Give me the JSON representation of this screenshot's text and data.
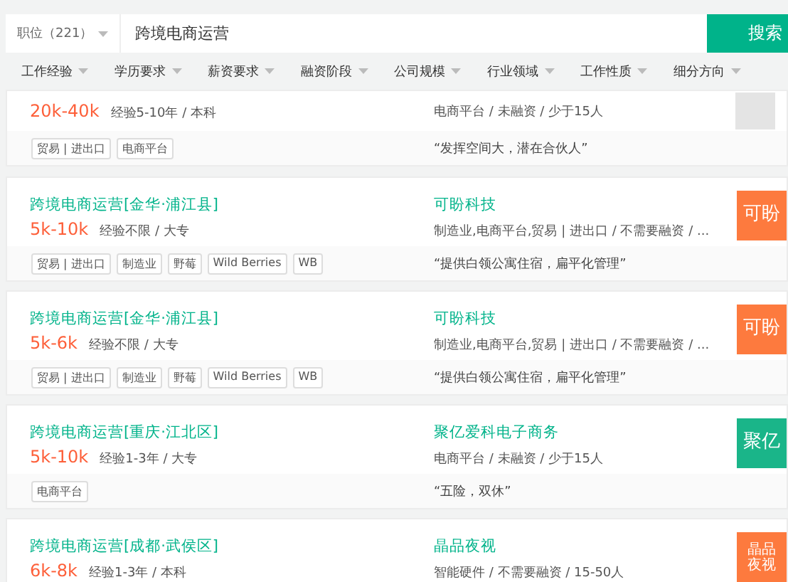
{
  "search": {
    "category": "职位（221）",
    "value": "跨境电商运营",
    "button": "搜索"
  },
  "filters": [
    "工作经验",
    "学历要求",
    "薪资要求",
    "融资阶段",
    "公司规模",
    "行业领域",
    "工作性质",
    "细分方向"
  ],
  "jobs": [
    {
      "salary": "20k-40k",
      "requirements": "经验5-10年 / 本科",
      "company_info": "电商平台 / 未融资 / 少于15人",
      "logo": {
        "kind": "image",
        "color": "#e4e4e4"
      },
      "tags": [
        "贸易 | 进出口",
        "电商平台"
      ],
      "quote": "“发挥空间大，潜在合伙人”"
    },
    {
      "title": "跨境电商运营[金华·浦江县]",
      "salary": "5k-10k",
      "requirements": "经验不限 / 大专",
      "company": "可盼科技",
      "company_info": "制造业,电商平台,贸易 | 进出口 / 不需要融资 / ...",
      "logo": {
        "kind": "text",
        "text": "可盼",
        "color": "#fd7a3e"
      },
      "tags": [
        "贸易 | 进出口",
        "制造业",
        "野莓",
        "Wild Berries",
        "WB"
      ],
      "quote": "“提供白领公寓住宿，扁平化管理”"
    },
    {
      "title": "跨境电商运营[金华·浦江县]",
      "salary": "5k-6k",
      "requirements": "经验不限 / 大专",
      "company": "可盼科技",
      "company_info": "制造业,电商平台,贸易 | 进出口 / 不需要融资 / ...",
      "logo": {
        "kind": "text",
        "text": "可盼",
        "color": "#fd7a3e"
      },
      "tags": [
        "贸易 | 进出口",
        "制造业",
        "野莓",
        "Wild Berries",
        "WB"
      ],
      "quote": "“提供白领公寓住宿，扁平化管理”"
    },
    {
      "title": "跨境电商运营[重庆·江北区]",
      "salary": "5k-10k",
      "requirements": "经验1-3年 / 大专",
      "company": "聚亿爱科电子商务",
      "company_info": "电商平台 / 未融资 / 少于15人",
      "logo": {
        "kind": "text",
        "text": "聚亿",
        "color": "#1ab589"
      },
      "tags": [
        "电商平台"
      ],
      "quote": "“五险，双休”"
    },
    {
      "title": "跨境电商运营[成都·武侯区]",
      "salary": "6k-8k",
      "requirements": "经验1-3年 / 本科",
      "company": "晶品夜视",
      "company_info": "智能硬件 / 不需要融资 / 15-50人",
      "logo": {
        "kind": "text",
        "text": "晶品夜视",
        "color": "#fd7a3e"
      }
    }
  ]
}
